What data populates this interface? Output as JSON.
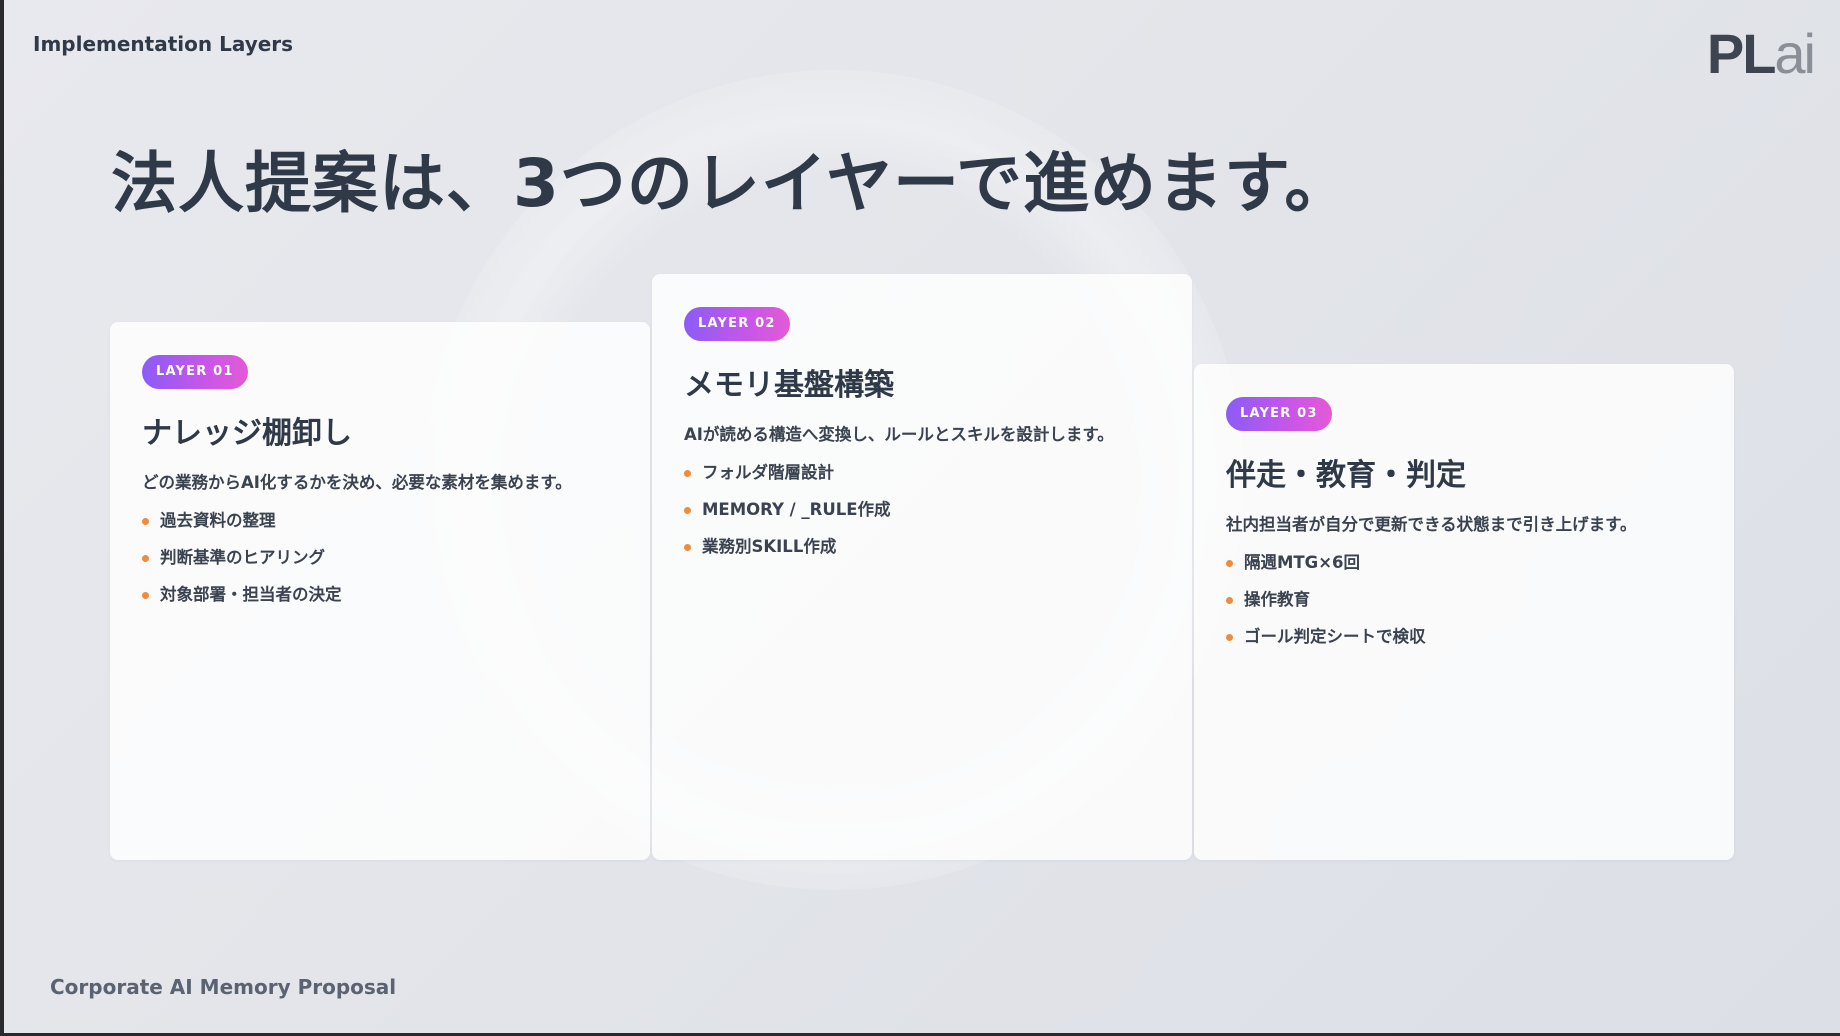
{
  "header": {
    "section_label": "Implementation Layers",
    "logo_main": "PL",
    "logo_suffix": "ai"
  },
  "headline": "法人提案は、3つのレイヤーで進めます。",
  "cards": [
    {
      "badge": "LAYER 01",
      "title": "ナレッジ棚卸し",
      "description": "どの業務からAI化するかを決め、必要な素材を集めます。",
      "bullets": [
        "過去資料の整理",
        "判断基準のヒアリング",
        "対象部署・担当者の決定"
      ]
    },
    {
      "badge": "LAYER 02",
      "title": "メモリ基盤構築",
      "description": "AIが読める構造へ変換し、ルールとスキルを設計します。",
      "bullets": [
        "フォルダ階層設計",
        "MEMORY / _RULE作成",
        "業務別SKILL作成"
      ]
    },
    {
      "badge": "LAYER 03",
      "title": "伴走・教育・判定",
      "description": "社内担当者が自分で更新できる状態まで引き上げます。",
      "bullets": [
        "隔週MTG×6回",
        "操作教育",
        "ゴール判定シートで検収"
      ]
    }
  ],
  "footer": "Corporate AI Memory Proposal",
  "colors": {
    "badge_gradient_start": "#8b5cf6",
    "badge_gradient_end": "#e35ad6",
    "bullet_dot": "#f08a3c",
    "text_dark": "#2f3948"
  }
}
